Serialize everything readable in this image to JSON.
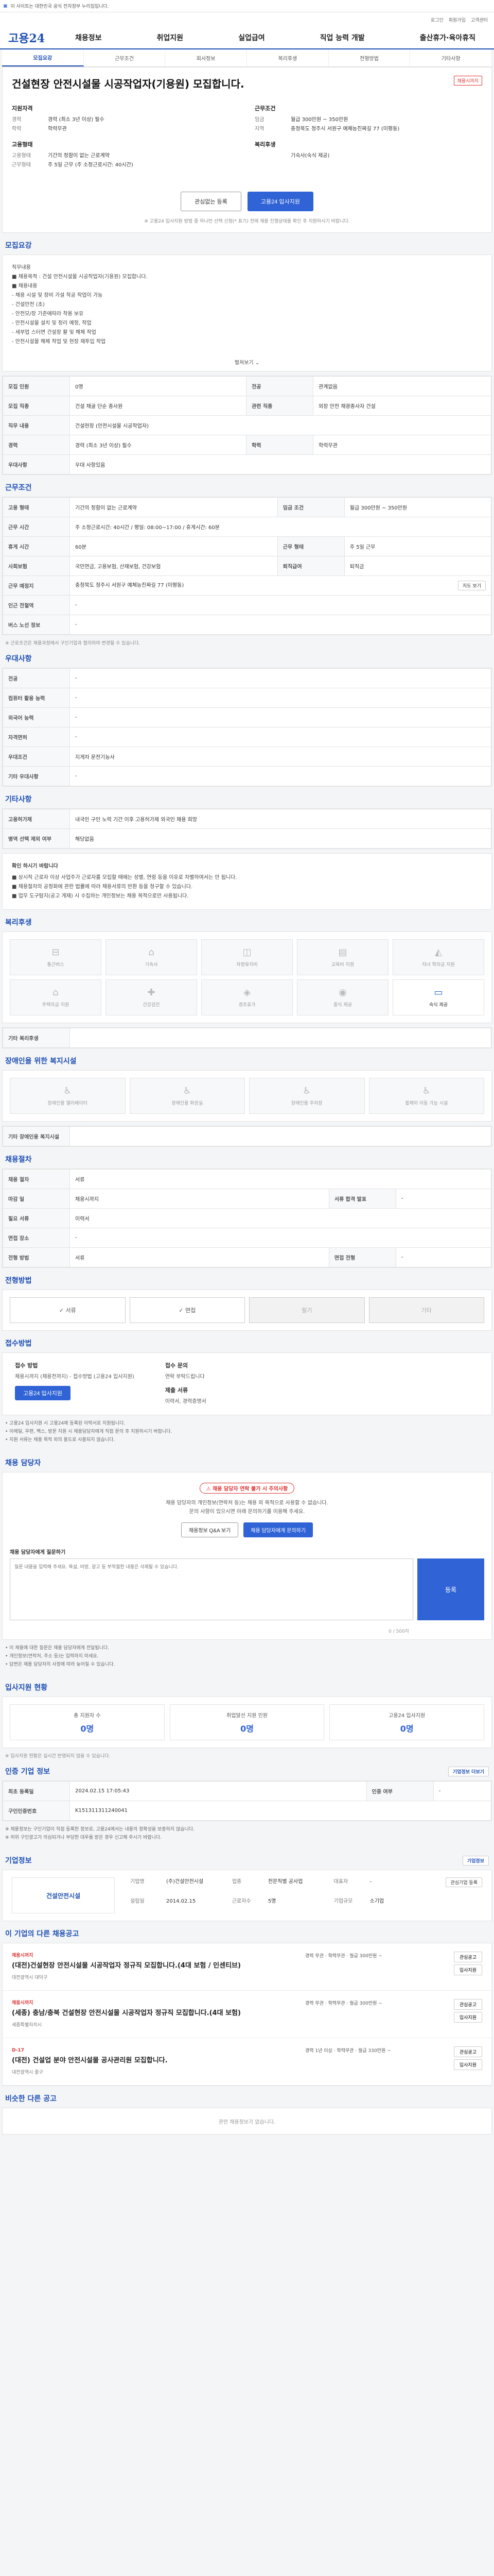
{
  "notice_bar": {
    "text": "이 사이트는 대한민국 공식 전자정부 누리집입니다."
  },
  "topbar": {
    "links": [
      "로그인",
      "회원가입",
      "고객센터"
    ]
  },
  "gnb": {
    "logo": "고용24",
    "menu": [
      "채용정보",
      "취업지원",
      "실업급여",
      "직업 능력 개발",
      "출산휴가·육아휴직"
    ]
  },
  "tabs": [
    "모집요강",
    "근무조건",
    "회사정보",
    "복리후생",
    "전형방법",
    "기타사항"
  ],
  "summary": {
    "title": "건설현장 안전시설물 시공작업자(기용원) 모집합니다.",
    "badge": "채용시까지",
    "groups": [
      {
        "heading": "지원자격",
        "items": [
          {
            "k": "경력",
            "v": "경력 (최소 3년 이상) 필수"
          },
          {
            "k": "학력",
            "v": "학력무관"
          }
        ]
      },
      {
        "heading": "근무조건",
        "items": [
          {
            "k": "임금",
            "v": "월급 300만원 ~ 350만원"
          },
          {
            "k": "지역",
            "v": "충청북도 청주시 서원구 예체능진짜길 77 (미평동)"
          }
        ]
      },
      {
        "heading": "고용형태",
        "items": [
          {
            "k": "고용형태",
            "v": "기간의 정함이 없는 근로계약"
          },
          {
            "k": "근무형태",
            "v": "주 5일 근무 (주 소정근로시간: 40시간)"
          }
        ]
      },
      {
        "heading": "복리후생",
        "items": [
          {
            "k": "",
            "v": "기숙사(숙식 제공)"
          }
        ]
      }
    ],
    "btn_interest": "관심없는 등록",
    "btn_apply": "고용24 입사지원",
    "footnote": "※ 고용24 입사지원 방법 중 하나만 선택 신청(* 표기) 전에 채용 진행상태를 확인 후 지원하시기 바랍니다."
  },
  "content": {
    "title": "모집요강",
    "text": [
      "직무내용",
      "■ 채용목적 : 건설 안전시설물 시공작업자(기용원) 모집합니다.",
      "■ 채용내용",
      "- 채용 시설 및 장비 가설 착공 작업이 가능",
      "- 건설안전 (초)",
      "- 안전모/장 기준에따라 착용 보유",
      "- 안전시설물 설치 및 정리 예정, 작업",
      "- 세부업 스터면 건설장 활 및 해체 작업",
      "- 안전시설물 해체 작업 및 현장 재투입 작업"
    ],
    "more": "펼쳐보기"
  },
  "recruit_table": [
    {
      "k": "모집 인원",
      "v": "0명",
      "k2": "전공",
      "v2": "관계없음"
    },
    {
      "k": "모집 직종",
      "v": "건설 채굴 단순 종사원",
      "k2": "관련 직종",
      "v2": "외장 안전 채광종사자 건설"
    },
    {
      "k": "직무 내용",
      "v": "건설현장 (안전시설물 시공작업자)",
      "k2": "",
      "v2": ""
    },
    {
      "k": "경력",
      "v": "경력 (최소 3년 이상) 필수",
      "k2": "학력",
      "v2": "학력무관"
    },
    {
      "k": "우대사항",
      "v": "우대 사항있음",
      "k2": "",
      "v2": ""
    }
  ],
  "work": {
    "title": "근무조건",
    "table": [
      {
        "k": "고용 형태",
        "v": "기간의 정함이 없는 근로계약",
        "k2": "임금 조건",
        "v2": "월급 300만원 ~ 350만원"
      },
      {
        "k": "근무 시간",
        "v": "주 소정근로시간: 40시간 / 평일: 08:00~17:00 / 휴게시간: 60분",
        "k2": "",
        "v2": ""
      },
      {
        "k": "휴게 시간",
        "v": "60분",
        "k2": "근무 형태",
        "v2": "주 5일 근무"
      },
      {
        "k": "사회보험",
        "v": "국민연금, 고용보험, 산재보험, 건강보험",
        "k2": "퇴직급여",
        "v2": "퇴직금"
      },
      {
        "k": "근무 예정지",
        "v": "충청북도 청주시 서원구 예체능진짜길 77 (미평동)",
        "k2": "",
        "v2": ""
      },
      {
        "k": "인근 전철역",
        "v": "-",
        "k2": "",
        "v2": ""
      },
      {
        "k": "버스 노선 정보",
        "v": "-",
        "k2": "",
        "v2": ""
      }
    ],
    "map_btn": "지도 보기",
    "note": "※ 근로조건은 채용과정에서 구인기업과 협의하여 변경될 수 있습니다."
  },
  "pref": {
    "title": "우대사항",
    "table": [
      {
        "k": "전공",
        "v": "-"
      },
      {
        "k": "컴퓨터 활용 능력",
        "v": "-"
      },
      {
        "k": "외국어 능력",
        "v": "-"
      },
      {
        "k": "자격면허",
        "v": "-"
      },
      {
        "k": "우대조건",
        "v": "지게차 운전기능사"
      },
      {
        "k": "기타 우대사항",
        "v": "-"
      }
    ]
  },
  "etc": {
    "title": "기타사항",
    "table": [
      {
        "k": "고용허가제",
        "v": "내국인 구인 노력 기간 이후 고용허가제 외국인 채용 희망"
      },
      {
        "k": "병역 선택 제외 여부",
        "v": "해당없음"
      }
    ],
    "notice_title": "확인 하시기 바랍니다",
    "notices": [
      "■ 상시직 근로자 이상 사업주가 근로자를 모집할 때에는 성별, 연령 등을 이유로 차별하여서는 안 됩니다.",
      "■ 채용절차의 공정화에 관한 법률에 따라 채용서류의 반환 등을 청구할 수 있습니다.",
      "■ 업무 도구탐지(공고 게재) 시 수집하는 개인정보는 채용 목적으로만 사용됩니다."
    ]
  },
  "benefit": {
    "title": "복리후생",
    "items": [
      {
        "name": "통근버스",
        "icon": "bus-icon",
        "on": false
      },
      {
        "name": "기숙사",
        "icon": "home-icon",
        "on": false
      },
      {
        "name": "차량유지비",
        "icon": "car-icon",
        "on": false
      },
      {
        "name": "교육비 지원",
        "icon": "book-icon",
        "on": false
      },
      {
        "name": "자녀 학자금 지원",
        "icon": "cap-icon",
        "on": false
      },
      {
        "name": "주택자금 지원",
        "icon": "house-icon",
        "on": false
      },
      {
        "name": "건강검진",
        "icon": "health-icon",
        "on": false
      },
      {
        "name": "경조휴가",
        "icon": "gift-icon",
        "on": false
      },
      {
        "name": "중식 제공",
        "icon": "meal-icon",
        "on": false
      },
      {
        "name": "숙식 제공",
        "icon": "bed-icon",
        "on": true
      }
    ],
    "etc_label": "기타 복리후생"
  },
  "disability": {
    "title": "장애인을 위한 복지시설",
    "items": [
      "장애인용 엘리베이터",
      "장애인용 화장실",
      "장애인용 주차장",
      "휠체어 이동 가능 시설"
    ],
    "etc_label": "기타 장애인용 복지시설"
  },
  "process": {
    "title": "채용절차",
    "table": [
      {
        "k": "채용 절차",
        "v": "서류",
        "k2": "",
        "v2": ""
      },
      {
        "k": "마감 일",
        "v": "채용시까지",
        "k2": "서류 합격 발표",
        "v2": "-"
      },
      {
        "k": "필요 서류",
        "v": "이력서",
        "k2": "",
        "v2": ""
      },
      {
        "k": "면접 장소",
        "v": "-",
        "k2": "",
        "v2": ""
      },
      {
        "k": "전형 방법",
        "v": "서류",
        "k2": "면접 전형",
        "v2": "-"
      }
    ]
  },
  "method": {
    "title": "전형방법",
    "items": [
      {
        "name": "서류",
        "on": true
      },
      {
        "name": "면접",
        "on": true
      },
      {
        "name": "필기",
        "on": false
      },
      {
        "name": "기타",
        "on": false
      }
    ]
  },
  "apply": {
    "title": "접수방법",
    "k1": "접수 방법",
    "v1": "채용시까지 (채용전까지) - 접수방법 (고용24 입사지원)",
    "btn": "고용24 입사지원",
    "k2": "접수 문의",
    "v2": "연락 부탁드립니다",
    "k3": "제출 서류",
    "v3": "이력서, 경력증명서",
    "notes": [
      "• 고용24 입사지원 시 고용24에 등록된 이력서로 지원됩니다.",
      "• 이메일, 우편, 팩스, 방문 지원 시 채용담당자에게 직접 문의 후 지원하시기 바랍니다.",
      "• 지원 서류는 채용 목적 외의 용도로 사용되지 않습니다."
    ]
  },
  "qa": {
    "title": "채용 담당자",
    "tag": "채용 담당자 연락 불가 시 주의사항",
    "text1": "채용 담당자의 개인정보(연락처 등)는 채용 외 목적으로 사용할 수 없습니다.",
    "text2": "문의 사항이 있으시면 아래 문의하기를 이용해 주세요.",
    "btn1": "채용정보 Q&A 보기",
    "btn2": "채용 담당자에게 문의하기",
    "form_label": "채용 담당자에게 질문하기",
    "placeholder": "질문 내용을 입력해 주세요. 욕설, 비방, 광고 등 부적절한 내용은 삭제될 수 있습니다.",
    "submit": "등록",
    "counter": "0 / 500자",
    "notes": [
      "• 이 채용에 대한 질문은 채용 담당자에게 전달됩니다.",
      "• 개인정보(연락처, 주소 등)는 입력하지 마세요.",
      "• 답변은 채용 담당자의 사정에 따라 늦어질 수 있습니다."
    ]
  },
  "stats": {
    "title": "입사지원 현황",
    "items": [
      {
        "label": "총 지원자 수",
        "value": "0명"
      },
      {
        "label": "취업알선 지원 인원",
        "value": "0명"
      },
      {
        "label": "고용24 입사지원",
        "value": "0명"
      }
    ],
    "note": "※ 입사지원 현황은 실시간 반영되지 않을 수 있습니다."
  },
  "info": {
    "title": "인증 기업 정보",
    "btn": "기업정보 더보기",
    "table": [
      {
        "k": "최초 등록일",
        "v": "2024.02.15 17:05:43",
        "k2": "인증 여부",
        "v2": "-"
      },
      {
        "k": "구인인증번호",
        "v": "K151311311240041"
      }
    ],
    "notes": [
      "※ 채용정보는 구인기업이 직접 등록한 정보로, 고용24에서는 내용의 정확성을 보증하지 않습니다.",
      "※ 허위 구인광고가 의심되거나 부당한 대우를 받은 경우 신고해 주시기 바랍니다."
    ]
  },
  "company": {
    "title": "기업정보",
    "logo_text": "건설안전시설",
    "more": "기업정보",
    "fields": [
      {
        "k": "기업명",
        "v": "(주)건설안전시설"
      },
      {
        "k": "업종",
        "v": "전문직별 공사업"
      },
      {
        "k": "대표자",
        "v": "-"
      },
      {
        "k": "설립일",
        "v": "2014.02.15"
      },
      {
        "k": "근로자수",
        "v": "5명"
      },
      {
        "k": "기업규모",
        "v": "소기업"
      }
    ],
    "follow": "관심기업 등록"
  },
  "jobs": {
    "title": "이 기업의 다른 채용공고",
    "items": [
      {
        "dday": "채용시까지",
        "title": "(대전)건설현장 안전시설물 시공작업자 정규직 모집합니다.(4대 보험 / 인센티브)",
        "meta": "대전광역시 대덕구",
        "cond": "경력 무관 · 학력무관 · 월급 300만원 ~",
        "b1": "관심공고",
        "b2": "입사지원"
      },
      {
        "dday": "채용시까지",
        "title": "(세종) 충남/충북 건설현장 안전시설물 시공작업자 정규직 모집합니다.(4대 보험)",
        "meta": "세종특별자치시",
        "cond": "경력 무관 · 학력무관 · 월급 300만원 ~",
        "b1": "관심공고",
        "b2": "입사지원"
      },
      {
        "dday": "D-17",
        "title": "(대전) 건설업 분야 안전시설물 공사관리원 모집합니다.",
        "meta": "대전광역시 중구",
        "cond": "경력 1년 이상 · 학력무관 · 월급 330만원 ~",
        "b1": "관심공고",
        "b2": "입사지원"
      }
    ]
  },
  "related": {
    "title": "비슷한 다른 공고",
    "empty": "관련 채용정보가 없습니다."
  },
  "colors": {
    "brand": "#1e4fb3",
    "accent": "#2f63d6",
    "warn": "#d33333"
  }
}
